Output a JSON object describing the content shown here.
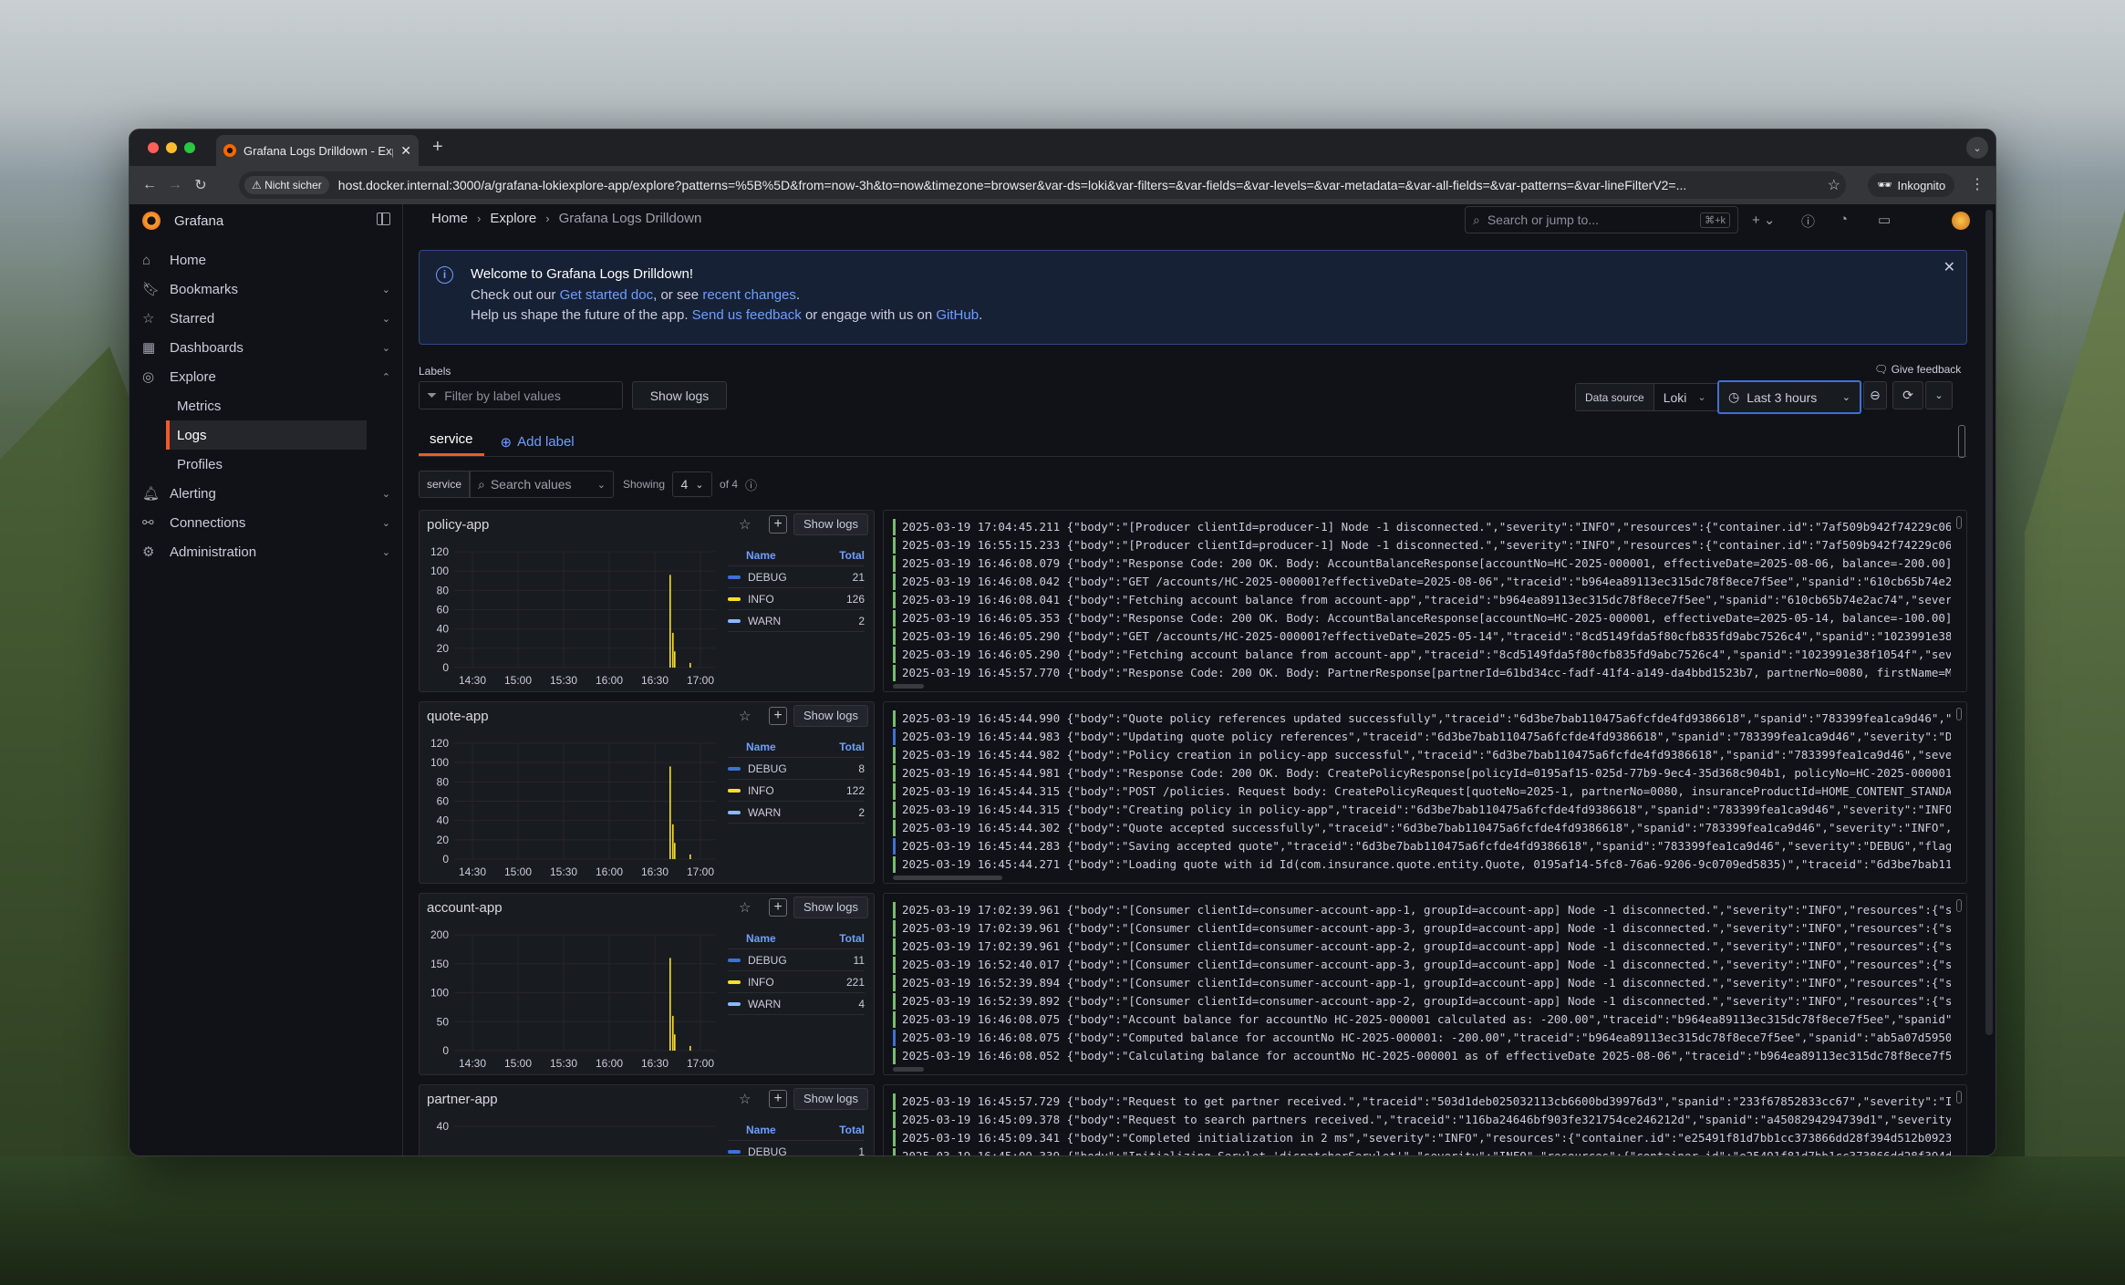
{
  "browser": {
    "tab_title": "Grafana Logs Drilldown - Exp",
    "insecure_label": "Nicht sicher",
    "url": "host.docker.internal:3000/a/grafana-lokiexplore-app/explore?patterns=%5B%5D&from=now-3h&to=now&timezone=browser&var-ds=loki&var-filters=&var-fields=&var-levels=&var-metadata=&var-all-fields=&var-patterns=&var-lineFilterV2=...",
    "incognito_label": "Inkognito"
  },
  "sidebar": {
    "brand": "Grafana",
    "items": [
      {
        "label": "Home",
        "icon": "home-icon"
      },
      {
        "label": "Bookmarks",
        "icon": "bookmark-icon"
      },
      {
        "label": "Starred",
        "icon": "star-icon"
      },
      {
        "label": "Dashboards",
        "icon": "dashboards-icon"
      },
      {
        "label": "Explore",
        "icon": "compass-icon"
      },
      {
        "label": "Alerting",
        "icon": "bell-icon"
      },
      {
        "label": "Connections",
        "icon": "connections-icon"
      },
      {
        "label": "Administration",
        "icon": "gear-icon"
      }
    ],
    "explore_sub": [
      "Metrics",
      "Logs",
      "Profiles"
    ]
  },
  "header": {
    "breadcrumbs": [
      "Home",
      "Explore",
      "Grafana Logs Drilldown"
    ],
    "search_placeholder": "Search or jump to...",
    "search_shortcut": "⌘+k"
  },
  "banner": {
    "title": "Welcome to Grafana Logs Drilldown!",
    "line2_a": "Check out our",
    "line2_link1": "Get started doc",
    "line2_b": ", or see",
    "line2_link2": "recent changes",
    "line2_c": ".",
    "line3_a": "Help us shape the future of the app.",
    "line3_link1": "Send us feedback",
    "line3_b": "or engage with us on",
    "line3_link2": "GitHub",
    "line3_c": "."
  },
  "toolbar": {
    "labels_title": "Labels",
    "filter_placeholder": "Filter by label values",
    "show_logs": "Show logs",
    "give_feedback": "Give feedback",
    "datasource_label": "Data source",
    "datasource_value": "Loki",
    "time_range": "Last 3 hours"
  },
  "tabs": {
    "active": "service",
    "add_label": "Add label"
  },
  "controls": {
    "service_label": "service",
    "search_placeholder": "Search values",
    "showing_label": "Showing",
    "showing_value": "4",
    "of_label": "of 4"
  },
  "legend_headers": {
    "name": "Name",
    "total": "Total"
  },
  "colors": {
    "debug": "#3d71d9",
    "info": "#fade2a",
    "warn": "#8ab8ff",
    "accent": "#f05a28"
  },
  "x_ticks": [
    "14:30",
    "15:00",
    "15:30",
    "16:00",
    "16:30",
    "17:00"
  ],
  "panels": [
    {
      "name": "policy-app",
      "show_logs": "Show logs",
      "y_ticks": [
        "120",
        "100",
        "80",
        "60",
        "40",
        "20",
        "0"
      ],
      "legend": [
        {
          "name": "DEBUG",
          "total": "21"
        },
        {
          "name": "INFO",
          "total": "126"
        },
        {
          "name": "WARN",
          "total": "2"
        }
      ],
      "logs": [
        {
          "lvl": "info",
          "text": "2025-03-19 17:04:45.211 {\"body\":\"[Producer clientId=producer-1] Node -1 disconnected.\",\"severity\":\"INFO\",\"resources\":{\"container.id\":\"7af509b942f74229c06aef"
        },
        {
          "lvl": "info",
          "text": "2025-03-19 16:55:15.233 {\"body\":\"[Producer clientId=producer-1] Node -1 disconnected.\",\"severity\":\"INFO\",\"resources\":{\"container.id\":\"7af509b942f74229c06aef"
        },
        {
          "lvl": "info",
          "text": "2025-03-19 16:46:08.079 {\"body\":\"Response Code: 200 OK. Body: AccountBalanceResponse[accountNo=HC-2025-000001, effectiveDate=2025-08-06, balance=-200.00]\",\""
        },
        {
          "lvl": "info",
          "text": "2025-03-19 16:46:08.042 {\"body\":\"GET /accounts/HC-2025-000001?effectiveDate=2025-08-06\",\"traceid\":\"b964ea89113ec315dc78f8ece7f5ee\",\"spanid\":\"610cb65b74e2a"
        },
        {
          "lvl": "info",
          "text": "2025-03-19 16:46:08.041 {\"body\":\"Fetching account balance from account-app\",\"traceid\":\"b964ea89113ec315dc78f8ece7f5ee\",\"spanid\":\"610cb65b74e2ac74\",\"severi"
        },
        {
          "lvl": "info",
          "text": "2025-03-19 16:46:05.353 {\"body\":\"Response Code: 200 OK. Body: AccountBalanceResponse[accountNo=HC-2025-000001, effectiveDate=2025-05-14, balance=-100.00]\",\""
        },
        {
          "lvl": "info",
          "text": "2025-03-19 16:46:05.290 {\"body\":\"GET /accounts/HC-2025-000001?effectiveDate=2025-05-14\",\"traceid\":\"8cd5149fda5f80cfb835fd9abc7526c4\",\"spanid\":\"1023991e38f10"
        },
        {
          "lvl": "info",
          "text": "2025-03-19 16:46:05.290 {\"body\":\"Fetching account balance from account-app\",\"traceid\":\"8cd5149fda5f80cfb835fd9abc7526c4\",\"spanid\":\"1023991e38f1054f\",\"severi"
        },
        {
          "lvl": "info",
          "text": "2025-03-19 16:45:57.770 {\"body\":\"Response Code: 200 OK. Body: PartnerResponse[partnerId=61bd34cc-fadf-41f4-a149-da4bbd1523b7, partnerNo=0080, firstName=Mary"
        }
      ]
    },
    {
      "name": "quote-app",
      "show_logs": "Show logs",
      "y_ticks": [
        "120",
        "100",
        "80",
        "60",
        "40",
        "20",
        "0"
      ],
      "legend": [
        {
          "name": "DEBUG",
          "total": "8"
        },
        {
          "name": "INFO",
          "total": "122"
        },
        {
          "name": "WARN",
          "total": "2"
        }
      ],
      "logs": [
        {
          "lvl": "info",
          "text": "2025-03-19 16:45:44.990 {\"body\":\"Quote policy references updated successfully\",\"traceid\":\"6d3be7bab110475a6fcfde4fd9386618\",\"spanid\":\"783399fea1ca9d46\",\"sev"
        },
        {
          "lvl": "dbg",
          "text": "2025-03-19 16:45:44.983 {\"body\":\"Updating quote policy references\",\"traceid\":\"6d3be7bab110475a6fcfde4fd9386618\",\"spanid\":\"783399fea1ca9d46\",\"severity\":\"DEBU"
        },
        {
          "lvl": "info",
          "text": "2025-03-19 16:45:44.982 {\"body\":\"Policy creation in policy-app successful\",\"traceid\":\"6d3be7bab110475a6fcfde4fd9386618\",\"spanid\":\"783399fea1ca9d46\",\"severit"
        },
        {
          "lvl": "info",
          "text": "2025-03-19 16:45:44.981 {\"body\":\"Response Code: 200 OK. Body: CreatePolicyResponse[policyId=0195af15-025d-77b9-9ec4-35d368c904b1, policyNo=HC-2025-000001]\","
        },
        {
          "lvl": "info",
          "text": "2025-03-19 16:45:44.315 {\"body\":\"POST /policies. Request body: CreatePolicyRequest[quoteNo=2025-1, partnerNo=0080, insuranceProductId=HOME_CONTENT_STANDARD_"
        },
        {
          "lvl": "info",
          "text": "2025-03-19 16:45:44.315 {\"body\":\"Creating policy in policy-app\",\"traceid\":\"6d3be7bab110475a6fcfde4fd9386618\",\"spanid\":\"783399fea1ca9d46\",\"severity\":\"INFO\",\""
        },
        {
          "lvl": "info",
          "text": "2025-03-19 16:45:44.302 {\"body\":\"Quote accepted successfully\",\"traceid\":\"6d3be7bab110475a6fcfde4fd9386618\",\"spanid\":\"783399fea1ca9d46\",\"severity\":\"INFO\",\"fl"
        },
        {
          "lvl": "dbg",
          "text": "2025-03-19 16:45:44.283 {\"body\":\"Saving accepted quote\",\"traceid\":\"6d3be7bab110475a6fcfde4fd9386618\",\"spanid\":\"783399fea1ca9d46\",\"severity\":\"DEBUG\",\"flags\":"
        },
        {
          "lvl": "info",
          "text": "2025-03-19 16:45:44.271 {\"body\":\"Loading quote with id Id(com.insurance.quote.entity.Quote, 0195af14-5fc8-76a6-9206-9c0709ed5835)\",\"traceid\":\"6d3be7bab11047"
        }
      ]
    },
    {
      "name": "account-app",
      "show_logs": "Show logs",
      "y_ticks": [
        "200",
        "150",
        "100",
        "50",
        "0"
      ],
      "legend": [
        {
          "name": "DEBUG",
          "total": "11"
        },
        {
          "name": "INFO",
          "total": "221"
        },
        {
          "name": "WARN",
          "total": "4"
        }
      ],
      "logs": [
        {
          "lvl": "info",
          "text": "2025-03-19 17:02:39.961 {\"body\":\"[Consumer clientId=consumer-account-app-1, groupId=account-app] Node -1 disconnected.\",\"severity\":\"INFO\",\"resources\":{\"serv"
        },
        {
          "lvl": "info",
          "text": "2025-03-19 17:02:39.961 {\"body\":\"[Consumer clientId=consumer-account-app-3, groupId=account-app] Node -1 disconnected.\",\"severity\":\"INFO\",\"resources\":{\"serv"
        },
        {
          "lvl": "info",
          "text": "2025-03-19 17:02:39.961 {\"body\":\"[Consumer clientId=consumer-account-app-2, groupId=account-app] Node -1 disconnected.\",\"severity\":\"INFO\",\"resources\":{\"serv"
        },
        {
          "lvl": "info",
          "text": "2025-03-19 16:52:40.017 {\"body\":\"[Consumer clientId=consumer-account-app-3, groupId=account-app] Node -1 disconnected.\",\"severity\":\"INFO\",\"resources\":{\"serv"
        },
        {
          "lvl": "info",
          "text": "2025-03-19 16:52:39.894 {\"body\":\"[Consumer clientId=consumer-account-app-1, groupId=account-app] Node -1 disconnected.\",\"severity\":\"INFO\",\"resources\":{\"serv"
        },
        {
          "lvl": "info",
          "text": "2025-03-19 16:52:39.892 {\"body\":\"[Consumer clientId=consumer-account-app-2, groupId=account-app] Node -1 disconnected.\",\"severity\":\"INFO\",\"resources\":{\"serv"
        },
        {
          "lvl": "info",
          "text": "2025-03-19 16:46:08.075 {\"body\":\"Account balance for accountNo HC-2025-000001 calculated as: -200.00\",\"traceid\":\"b964ea89113ec315dc78f8ece7f5ee\",\"spanid\":"
        },
        {
          "lvl": "dbg",
          "text": "2025-03-19 16:46:08.075 {\"body\":\"Computed balance for accountNo HC-2025-000001: -200.00\",\"traceid\":\"b964ea89113ec315dc78f8ece7f5ee\",\"spanid\":\"ab5a07d5950f"
        },
        {
          "lvl": "info",
          "text": "2025-03-19 16:46:08.052 {\"body\":\"Calculating balance for accountNo HC-2025-000001 as of effectiveDate 2025-08-06\",\"traceid\":\"b964ea89113ec315dc78f8ece7f5ee"
        }
      ]
    },
    {
      "name": "partner-app",
      "show_logs": "Show logs",
      "y_ticks": [
        "40"
      ],
      "legend": [
        {
          "name": "DEBUG",
          "total": "1"
        }
      ],
      "logs": [
        {
          "lvl": "info",
          "text": "2025-03-19 16:45:57.729 {\"body\":\"Request to get partner received.\",\"traceid\":\"503d1deb025032113cb6600bd39976d3\",\"spanid\":\"233f67852833cc67\",\"severity\":\"INFO"
        },
        {
          "lvl": "info",
          "text": "2025-03-19 16:45:09.378 {\"body\":\"Request to search partners received.\",\"traceid\":\"116ba24646bf903fe321754ce246212d\",\"spanid\":\"a4508294294739d1\",\"severity\":\""
        },
        {
          "lvl": "info",
          "text": "2025-03-19 16:45:09.341 {\"body\":\"Completed initialization in 2 ms\",\"severity\":\"INFO\",\"resources\":{\"container.id\":\"e25491f81d7bb1cc373866dd28f394d512b09238b7"
        },
        {
          "lvl": "info",
          "text": "2025-03-19 16:45:09.339 {\"body\":\"Initializing Servlet 'dispatcherServlet'\",\"severity\":\"INFO\",\"resources\":{\"container.id\":\"e25491f81d7bb1cc373866dd28f394d512"
        }
      ]
    }
  ]
}
